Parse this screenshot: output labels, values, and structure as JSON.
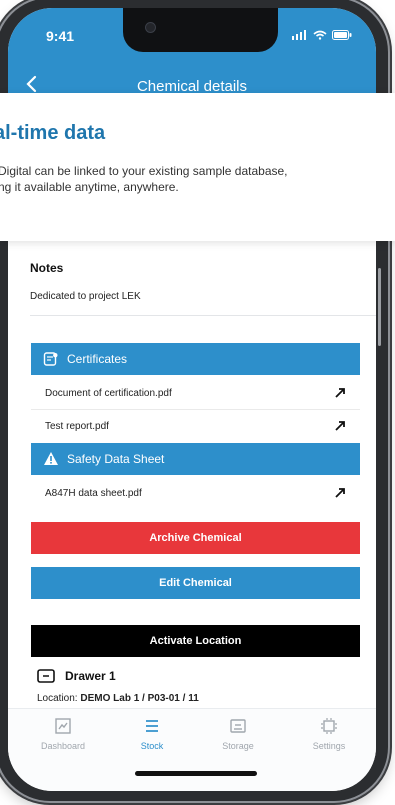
{
  "status_bar": {
    "time": "9:41"
  },
  "header": {
    "title": "Chemical details",
    "back_icon": "chevron-left-icon"
  },
  "marketing": {
    "title": "al-time data",
    "line1": "Digital can be linked to your existing sample database,",
    "line2": "ng it available anytime, anywhere."
  },
  "notes": {
    "label": "Notes",
    "text": "Dedicated to project LEK"
  },
  "certificates": {
    "label": "Certificates",
    "items": [
      {
        "name": "Document of certification.pdf"
      },
      {
        "name": "Test report.pdf"
      }
    ]
  },
  "safety": {
    "label": "Safety Data Sheet",
    "items": [
      {
        "name": "A847H data sheet.pdf"
      }
    ]
  },
  "actions": {
    "archive": "Archive Chemical",
    "edit": "Edit Chemical",
    "activate": "Activate Location"
  },
  "location": {
    "title": "Drawer 1",
    "prefix": "Location:",
    "value": "DEMO Lab 1 / P03-01 / 11"
  },
  "nav": {
    "items": [
      {
        "label": "Dashboard",
        "icon": "dashboard-icon",
        "active": false
      },
      {
        "label": "Stock",
        "icon": "stock-icon",
        "active": true
      },
      {
        "label": "Storage",
        "icon": "storage-icon",
        "active": false
      },
      {
        "label": "Settings",
        "icon": "settings-icon",
        "active": false
      }
    ]
  },
  "colors": {
    "brand_blue": "#2d8fcb",
    "archive_red": "#e8373b",
    "black": "#000000",
    "heading_blue": "#1f76ad"
  }
}
